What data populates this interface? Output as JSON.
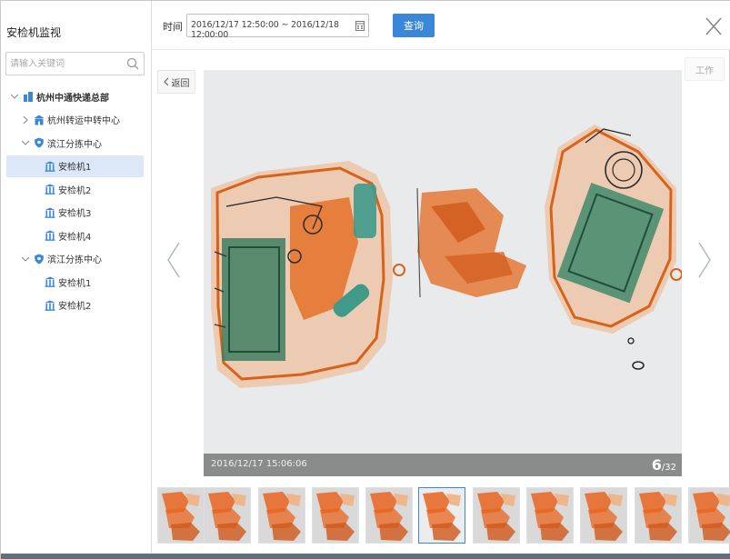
{
  "sidebar": {
    "title": "安检机监视",
    "search_placeholder": "请输入关键词",
    "tree": [
      {
        "label": "杭州中通快递总部",
        "level": 0,
        "type": "org",
        "expanded": true,
        "selected": false
      },
      {
        "label": "杭州转运中转中心",
        "level": 1,
        "type": "building",
        "expanded": false,
        "selected": false
      },
      {
        "label": "滨江分拣中心",
        "level": 1,
        "type": "shield",
        "expanded": true,
        "selected": false
      },
      {
        "label": "安检机1",
        "level": 2,
        "type": "machine",
        "expanded": false,
        "selected": true
      },
      {
        "label": "安检机2",
        "level": 2,
        "type": "machine",
        "expanded": false,
        "selected": false
      },
      {
        "label": "安检机3",
        "level": 2,
        "type": "machine",
        "expanded": false,
        "selected": false
      },
      {
        "label": "安检机4",
        "level": 2,
        "type": "machine",
        "expanded": false,
        "selected": false
      },
      {
        "label": "滨江分拣中心",
        "level": 1,
        "type": "shield",
        "expanded": true,
        "selected": false
      },
      {
        "label": "安检机1",
        "level": 2,
        "type": "machine",
        "expanded": false,
        "selected": false
      },
      {
        "label": "安检机2",
        "level": 2,
        "type": "machine",
        "expanded": false,
        "selected": false
      }
    ]
  },
  "topbar": {
    "time_label": "时间",
    "time_range": "2016/12/17 12:50:00 ~ 2016/12/18 12:00:00",
    "query_label": "查询"
  },
  "viewer": {
    "back_label": "返回",
    "work_label": "工作",
    "caption_time": "2016/12/17 15:06:06",
    "current_index": "6",
    "total": "/32"
  },
  "thumbnails": {
    "count": 11,
    "active_index": 5
  },
  "colors": {
    "accent": "#3a86d8",
    "selected_row": "#dce8f8",
    "xray_orange": "#e8641e",
    "xray_green": "#2f8f6a"
  }
}
